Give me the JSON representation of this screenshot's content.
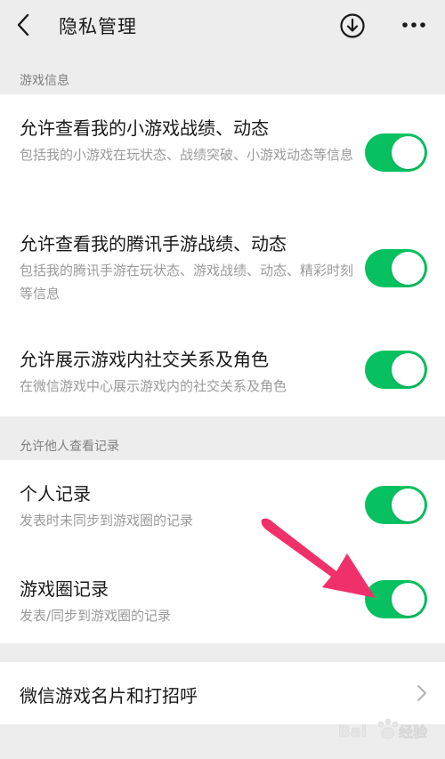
{
  "header": {
    "title": "隐私管理"
  },
  "section_game_info": {
    "label": "游戏信息",
    "items": [
      {
        "title": "允许查看我的小游戏战绩、动态",
        "desc": "包括我的小游戏在玩状态、战绩突破、小游戏动态等信息",
        "enabled": true
      },
      {
        "title": "允许查看我的腾讯手游战绩、动态",
        "desc": "包括我的腾讯手游在玩状态、游戏战绩、动态、精彩时刻等信息",
        "enabled": true
      },
      {
        "title": "允许展示游戏内社交关系及角色",
        "desc": "在微信游戏中心展示游戏内的社交关系及角色",
        "enabled": true
      }
    ]
  },
  "section_records": {
    "label": "允许他人查看记录",
    "items": [
      {
        "title": "个人记录",
        "desc": "发表时未同步到游戏圈的记录",
        "enabled": true
      },
      {
        "title": "游戏圈记录",
        "desc": "发表/同步到游戏圈的记录",
        "enabled": true
      }
    ]
  },
  "card_link": {
    "label": "微信游戏名片和打招呼"
  },
  "colors": {
    "toggle_on": "#07c160",
    "arrow": "#f0306a",
    "background": "#ededed"
  }
}
